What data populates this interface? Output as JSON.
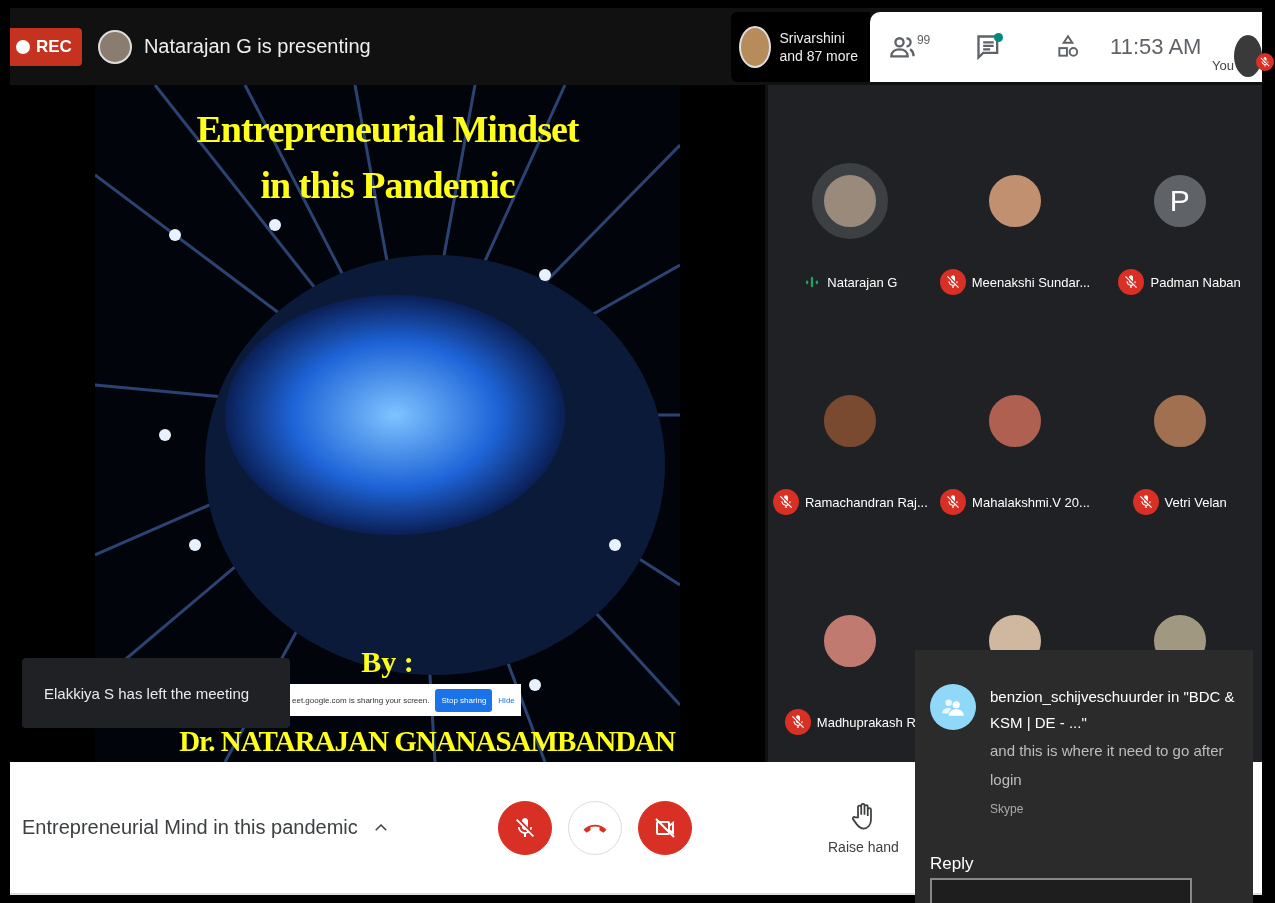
{
  "top_bar": {
    "recording": {
      "label": "REC"
    },
    "presenter": {
      "text": "Natarajan G is presenting"
    },
    "others": {
      "name": "Srivarshini",
      "more": "and 87 more"
    },
    "people": {
      "count": "99"
    },
    "chat": {
      "unread": true
    },
    "time": "11:53 AM",
    "self": {
      "label": "You",
      "muted": true
    }
  },
  "slide": {
    "title": [
      "Entrepreneurial Mindset",
      "in this Pandemic"
    ],
    "by": "By :",
    "author": "Dr. NATARAJAN GNANASAMBANDAN"
  },
  "toast": {
    "text": "Elakkiya S has left the meeting"
  },
  "share_bar": {
    "text": "eet.google.com is sharing your screen.",
    "stop": "Stop sharing",
    "hide": "Hide"
  },
  "participants": [
    {
      "name": "Natarajan G",
      "muted": false,
      "kind": "photo"
    },
    {
      "name": "Meenakshi Sundar...",
      "muted": true,
      "kind": "photo"
    },
    {
      "name": "Padman Naban",
      "muted": true,
      "kind": "letter",
      "letter": "P"
    },
    {
      "name": "Ramachandran Raj...",
      "muted": true,
      "kind": "photo"
    },
    {
      "name": "Mahalakshmi.V 20...",
      "muted": true,
      "kind": "photo"
    },
    {
      "name": "Vetri Velan",
      "muted": true,
      "kind": "photo"
    },
    {
      "name": "Madhuprakash R",
      "muted": true,
      "kind": "photo"
    },
    {
      "kind": "photo"
    },
    {
      "kind": "photo"
    }
  ],
  "bottom_bar": {
    "meeting_title": "Entrepreneurial Mind in this pandemic",
    "mic_off": true,
    "camera_off": true,
    "raise_hand": "Raise hand"
  },
  "notification": {
    "title": "benzion_schijveschuurder in \"BDC & KSM | DE - ...\"",
    "message": "and this is where it need to go after login",
    "app": "Skype",
    "reply": "Reply"
  }
}
